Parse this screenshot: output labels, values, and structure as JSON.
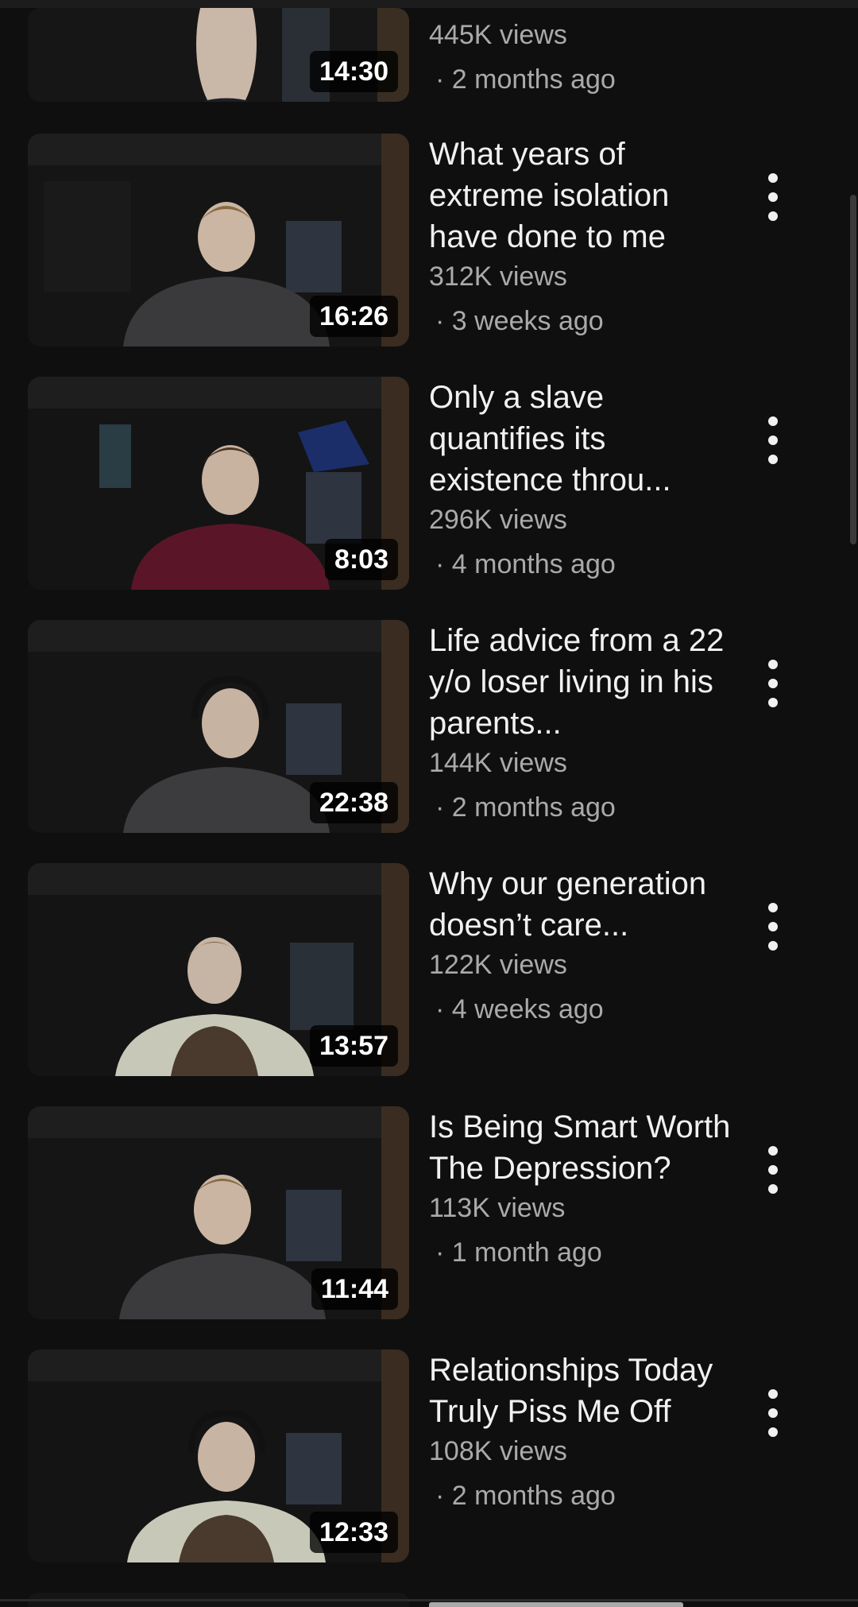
{
  "videos": [
    {
      "title": "",
      "views": "445K views",
      "age": "· 2 months ago",
      "duration": "14:30",
      "shirt": "#1f1f25"
    },
    {
      "title": "What years of extreme isolation have done to me",
      "views": "312K views",
      "age": "· 3 weeks ago",
      "duration": "16:26",
      "shirt": "#3a3a3d"
    },
    {
      "title": "Only a slave quantifies its existence throu...",
      "views": "296K views",
      "age": "· 4 months ago",
      "duration": "8:03",
      "shirt": "#5a1628"
    },
    {
      "title": "Life advice from a 22 y/o loser living in his parents...",
      "views": "144K views",
      "age": "· 2 months ago",
      "duration": "22:38",
      "shirt": "#3c3c3f"
    },
    {
      "title": "Why our generation doesn’t care...",
      "views": "122K views",
      "age": "· 4 weeks ago",
      "duration": "13:57",
      "shirt": "#4a3a2e"
    },
    {
      "title": "Is Being Smart Worth The Depression?",
      "views": "113K views",
      "age": "· 1 month ago",
      "duration": "11:44",
      "shirt": "#3b3b3e"
    },
    {
      "title": "Relationships Today Truly Piss Me Off",
      "views": "108K views",
      "age": "· 2 months ago",
      "duration": "12:33",
      "shirt": "#4a3a2e"
    }
  ]
}
